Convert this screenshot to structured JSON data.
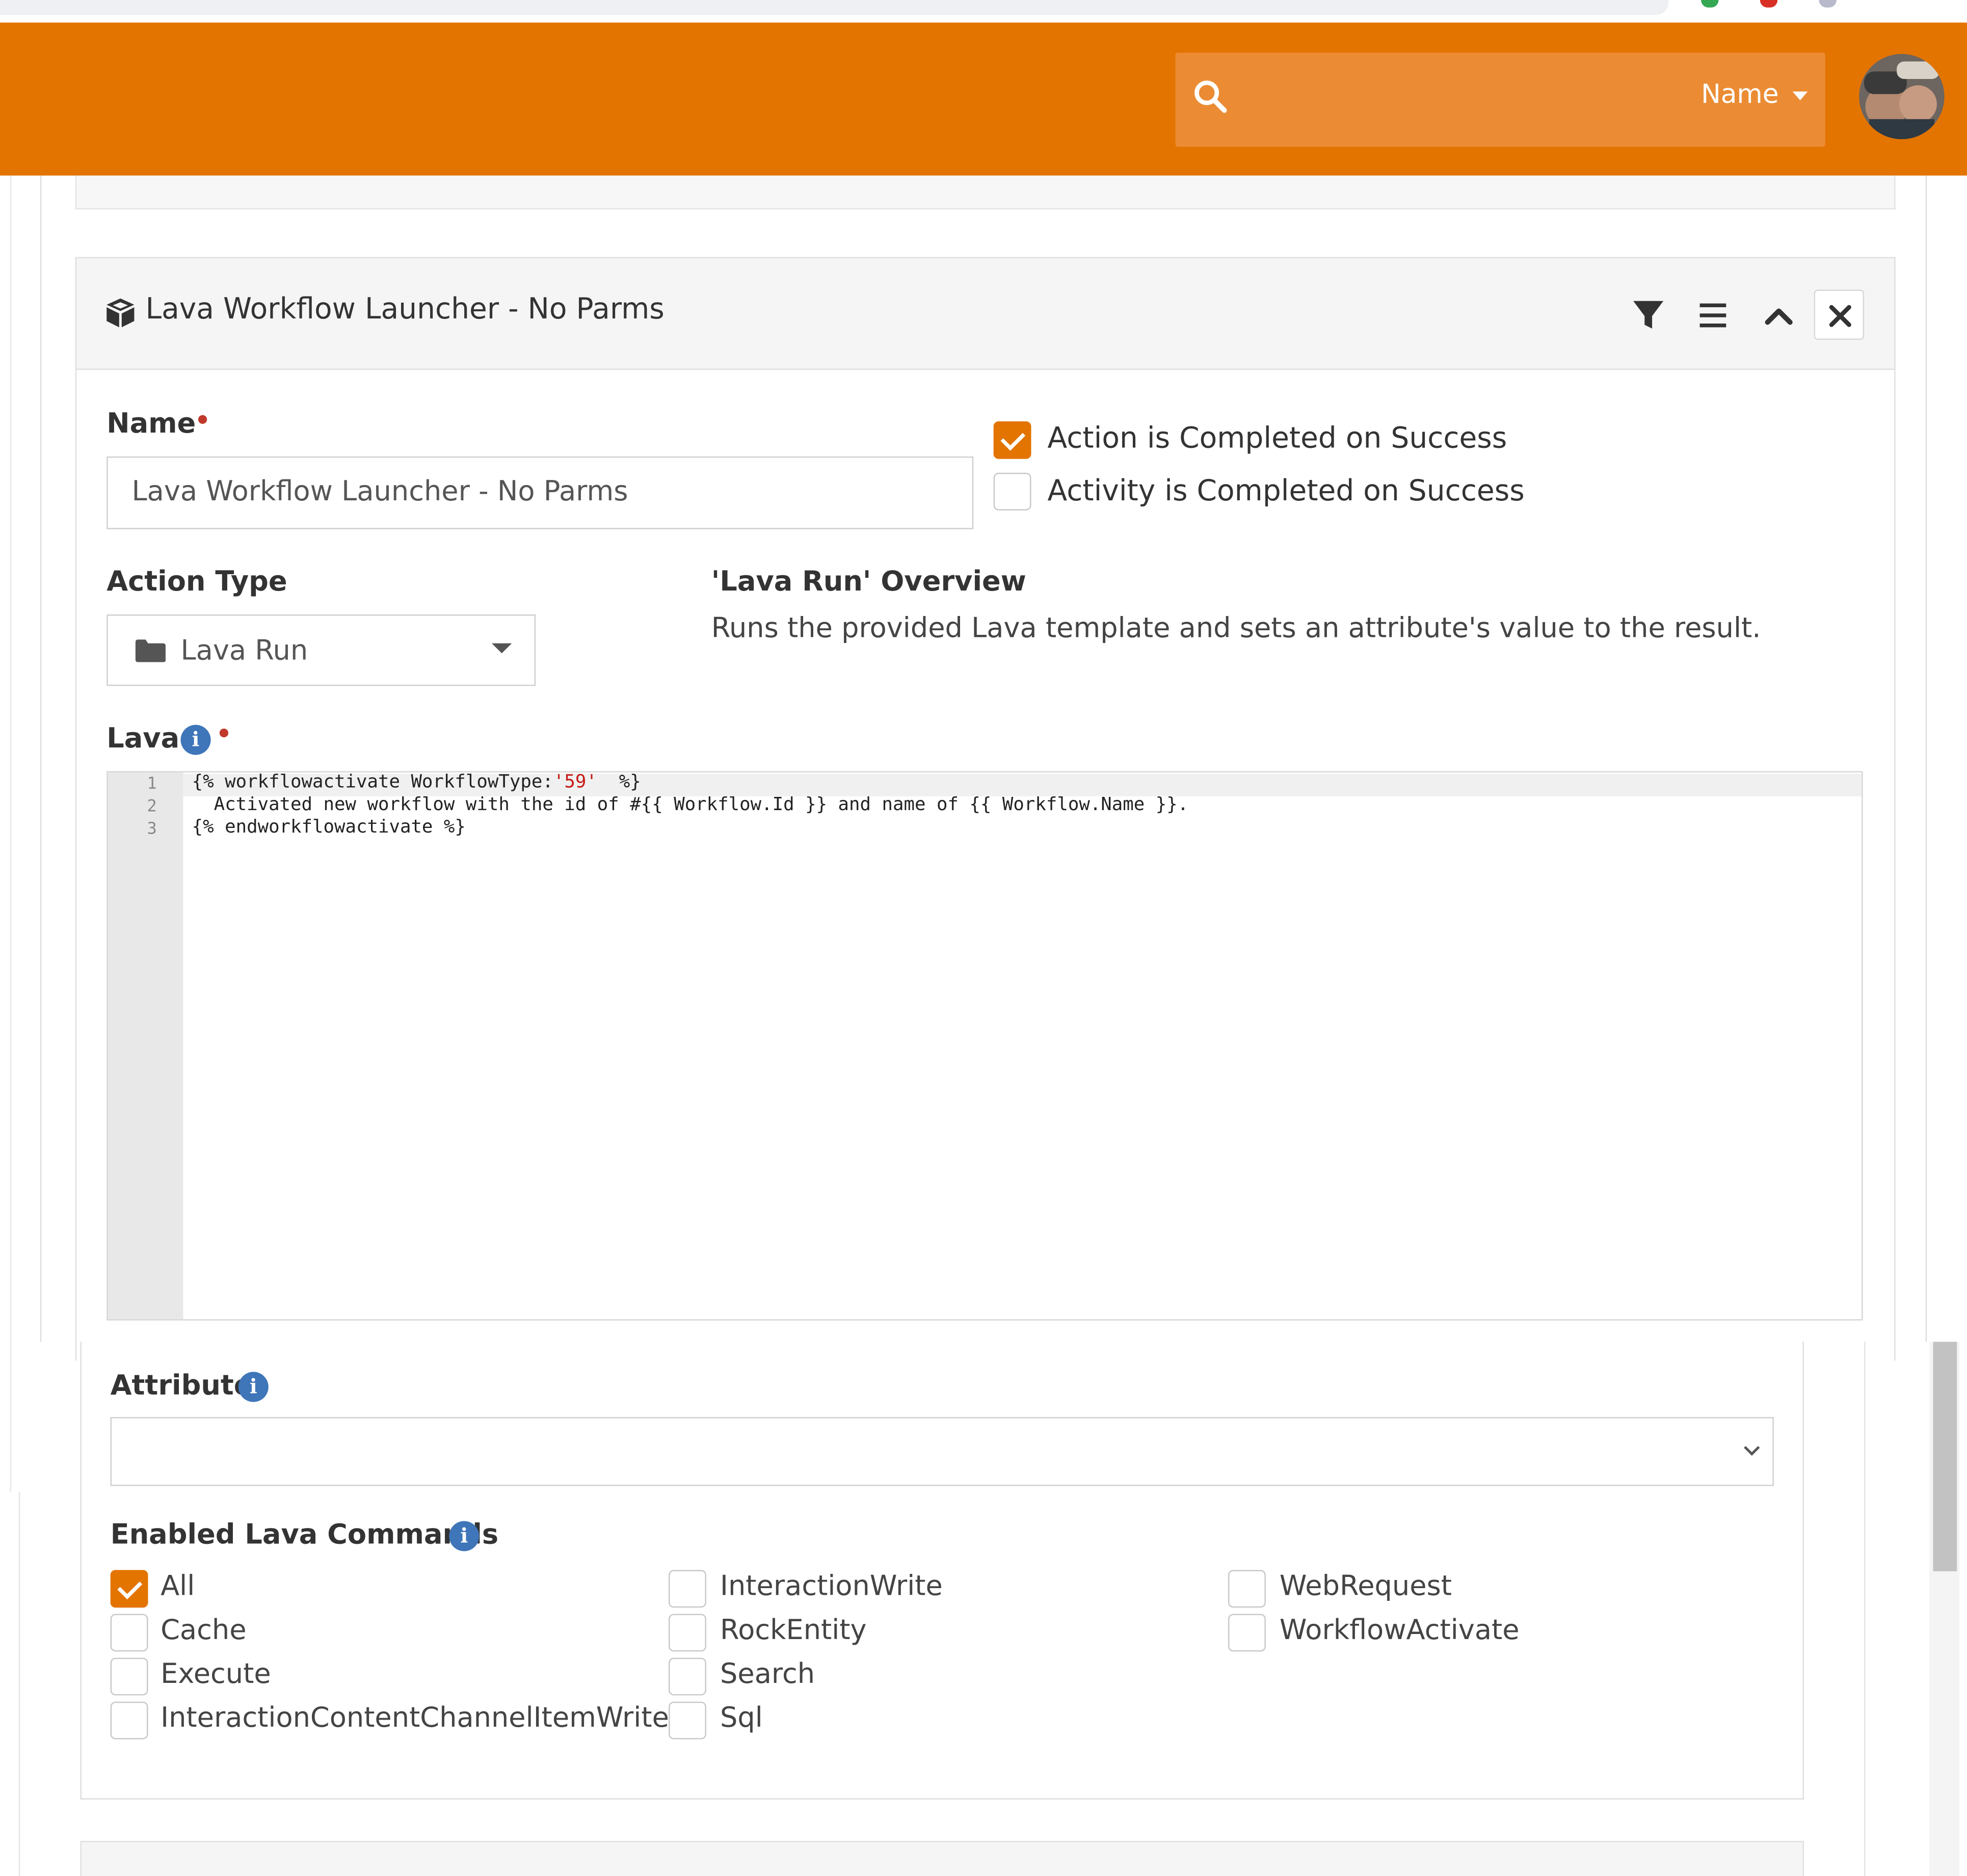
{
  "header": {
    "search_dropdown_label": "Name"
  },
  "panel": {
    "title": "Lava Workflow Launcher - No Parms"
  },
  "form": {
    "name_label": "Name",
    "name_value": "Lava Workflow Launcher - No Parms",
    "action_completed_label": "Action is Completed on Success",
    "action_completed_checked": true,
    "activity_completed_label": "Activity is Completed on Success",
    "activity_completed_checked": false,
    "action_type_label": "Action Type",
    "action_type_value": "Lava Run",
    "overview_title": "'Lava Run' Overview",
    "overview_text": "Runs the provided Lava template and sets an attribute's value to the result.",
    "lava_label": "Lava",
    "attribute_label": "Attribute",
    "attribute_value": "",
    "enabled_commands_label": "Enabled Lava Commands"
  },
  "editor": {
    "line_numbers": [
      "1",
      "2",
      "3"
    ],
    "line1_prefix": "{% workflowactivate WorkflowType:",
    "line1_string": "'59'",
    "line1_suffix": "  %}",
    "line2": "  Activated new workflow with the id of #{{ Workflow.Id }} and name of {{ Workflow.Name }}.",
    "line3": "{% endworkflowactivate %}"
  },
  "commands": [
    {
      "label": "All",
      "checked": true
    },
    {
      "label": "Cache",
      "checked": false
    },
    {
      "label": "Execute",
      "checked": false
    },
    {
      "label": "InteractionContentChannelItemWrite",
      "checked": false
    },
    {
      "label": "InteractionWrite",
      "checked": false
    },
    {
      "label": "RockEntity",
      "checked": false
    },
    {
      "label": "Search",
      "checked": false
    },
    {
      "label": "Sql",
      "checked": false
    },
    {
      "label": "WebRequest",
      "checked": false
    },
    {
      "label": "WorkflowActivate",
      "checked": false
    }
  ],
  "colors": {
    "brand_orange": "#e37400",
    "search_box": "#eb8c34",
    "info_blue": "#3f75b9",
    "required_red": "#c0392b"
  },
  "icons": {
    "search": "search-icon",
    "panel": "cube-icon",
    "filter": "filter-icon",
    "menu": "bars-icon",
    "collapse": "chevron-up-icon",
    "close": "close-icon",
    "action_type": "folder-icon",
    "info": "info-icon"
  }
}
